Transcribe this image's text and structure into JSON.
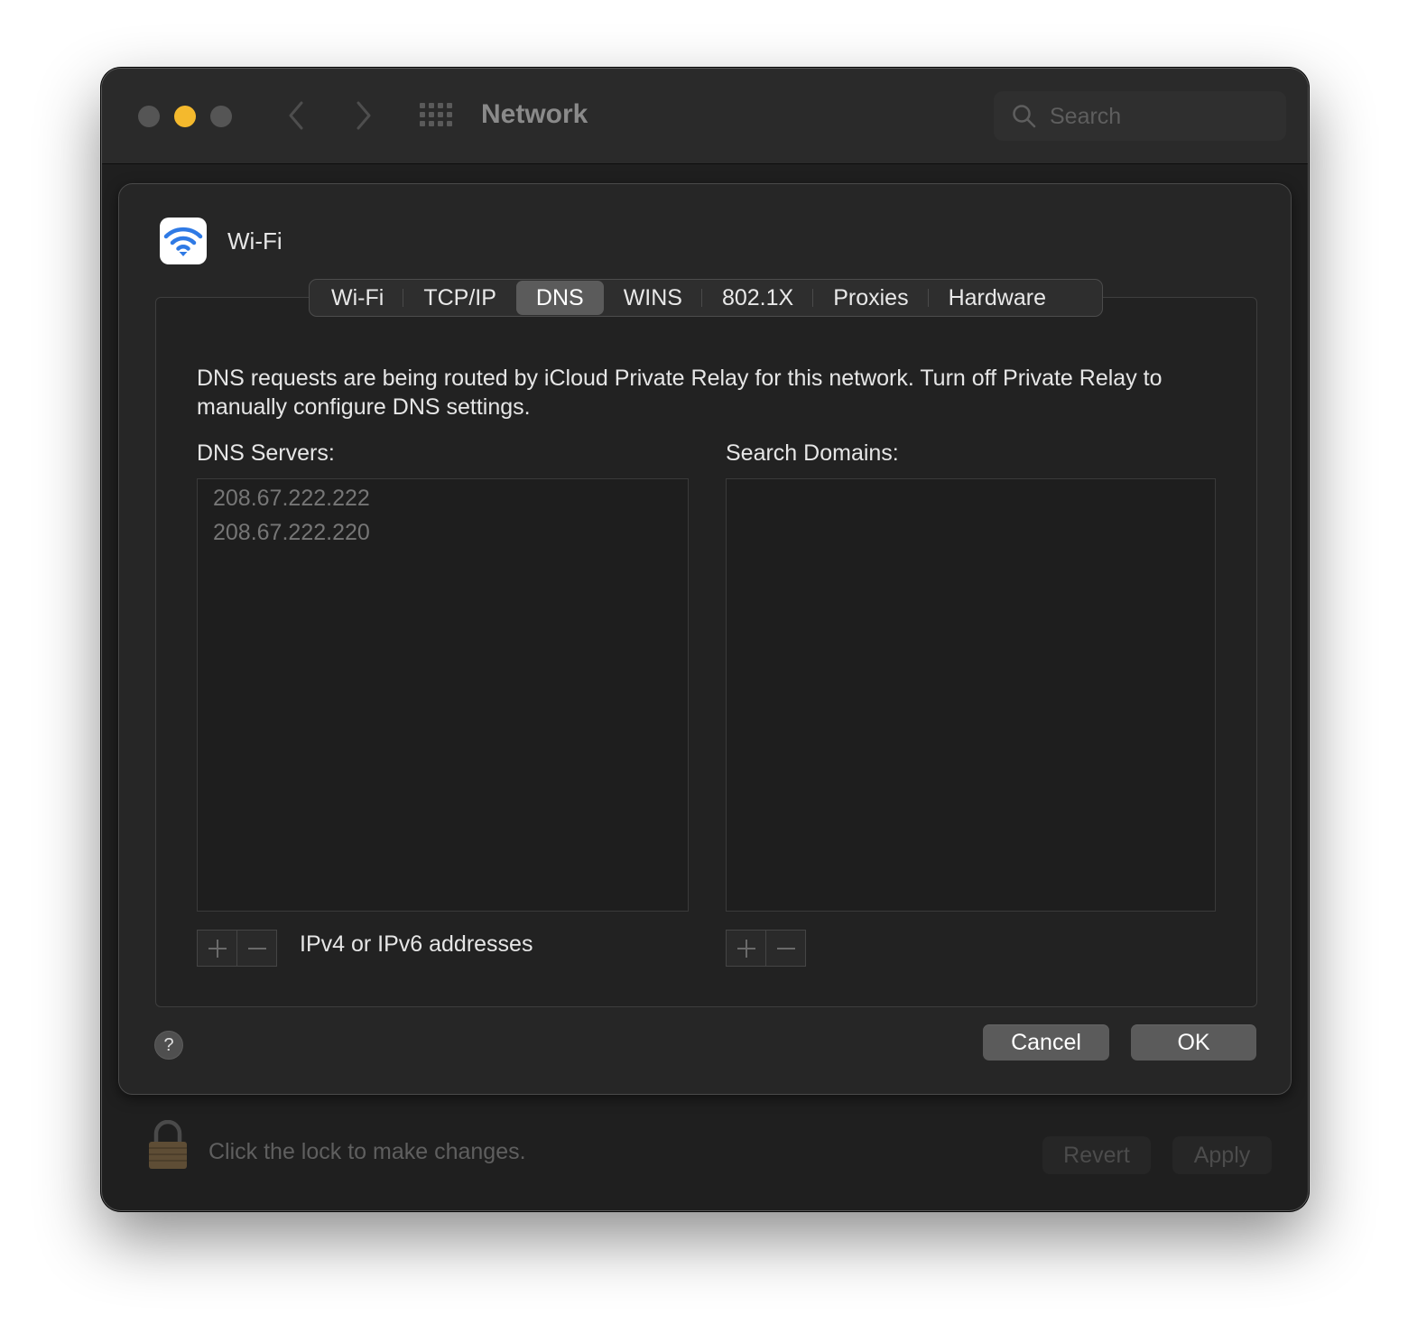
{
  "window": {
    "title": "Network",
    "search_placeholder": "Search"
  },
  "traffic_lights": {
    "close_color": "#555555",
    "minimize_color": "#f4b92d",
    "zoom_color": "#555555"
  },
  "sheet": {
    "interface_name": "Wi-Fi",
    "tabs": [
      {
        "label": "Wi-Fi",
        "active": false
      },
      {
        "label": "TCP/IP",
        "active": false
      },
      {
        "label": "DNS",
        "active": true
      },
      {
        "label": "WINS",
        "active": false
      },
      {
        "label": "802.1X",
        "active": false
      },
      {
        "label": "Proxies",
        "active": false
      },
      {
        "label": "Hardware",
        "active": false
      }
    ],
    "info_text": "DNS requests are being routed by iCloud Private Relay for this network. Turn off Private Relay to manually configure DNS settings.",
    "dns_servers_label": "DNS Servers:",
    "dns_servers": [
      "208.67.222.222",
      "208.67.222.220"
    ],
    "search_domains_label": "Search Domains:",
    "search_domains": [],
    "address_hint": "IPv4 or IPv6 addresses",
    "help_label": "?",
    "cancel_label": "Cancel",
    "ok_label": "OK"
  },
  "footer": {
    "lock_text": "Click the lock to make changes.",
    "revert_label": "Revert",
    "apply_label": "Apply"
  },
  "colors": {
    "accent_wifi": "#2f7ae5",
    "button_gray": "#5b5b5b",
    "window_bg": "#1f1f1f"
  }
}
